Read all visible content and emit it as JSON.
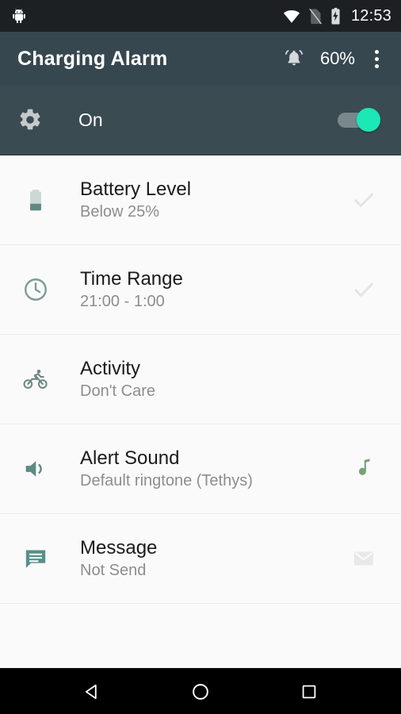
{
  "statusbar": {
    "app_icon": "android-robot-icon",
    "icons": [
      "wifi-icon",
      "sim-card-off-icon",
      "battery-charging-icon"
    ],
    "time": "12:53"
  },
  "appbar": {
    "title": "Charging Alarm",
    "bell_icon": "notification-bell-ringing-icon",
    "battery_percent": "60%",
    "overflow_icon": "overflow-menu-icon"
  },
  "master": {
    "icon": "gear-icon",
    "label": "On",
    "switch_state": "on",
    "accent": "#1ce8b5"
  },
  "list": {
    "items": [
      {
        "icon": "battery-icon",
        "title": "Battery Level",
        "subtitle": "Below 25%",
        "action_icon": "check-icon",
        "action_color": "#e4e4e4"
      },
      {
        "icon": "clock-icon",
        "title": "Time Range",
        "subtitle": "21:00 - 1:00",
        "action_icon": "check-icon",
        "action_color": "#e4e4e4"
      },
      {
        "icon": "bicycle-icon",
        "title": "Activity",
        "subtitle": "Don't Care",
        "action_icon": "",
        "action_color": ""
      },
      {
        "icon": "speaker-icon",
        "title": "Alert Sound",
        "subtitle": "Default ringtone (Tethys)",
        "action_icon": "music-note-icon",
        "action_color": "#76a376"
      },
      {
        "icon": "message-bubble-icon",
        "title": "Message",
        "subtitle": "Not Send",
        "action_icon": "envelope-icon",
        "action_color": "#e8e8e8"
      }
    ]
  },
  "navbar": {
    "back": "back-triangle-icon",
    "home": "home-circle-icon",
    "recents": "recents-square-icon"
  },
  "colors": {
    "statusbar_bg": "#1c2023",
    "appbar_bg": "#37474f",
    "master_bg": "#3b4b52",
    "content_bg": "#fafafa",
    "icon_teal": "#5d8a84",
    "navbar_bg": "#000000"
  }
}
